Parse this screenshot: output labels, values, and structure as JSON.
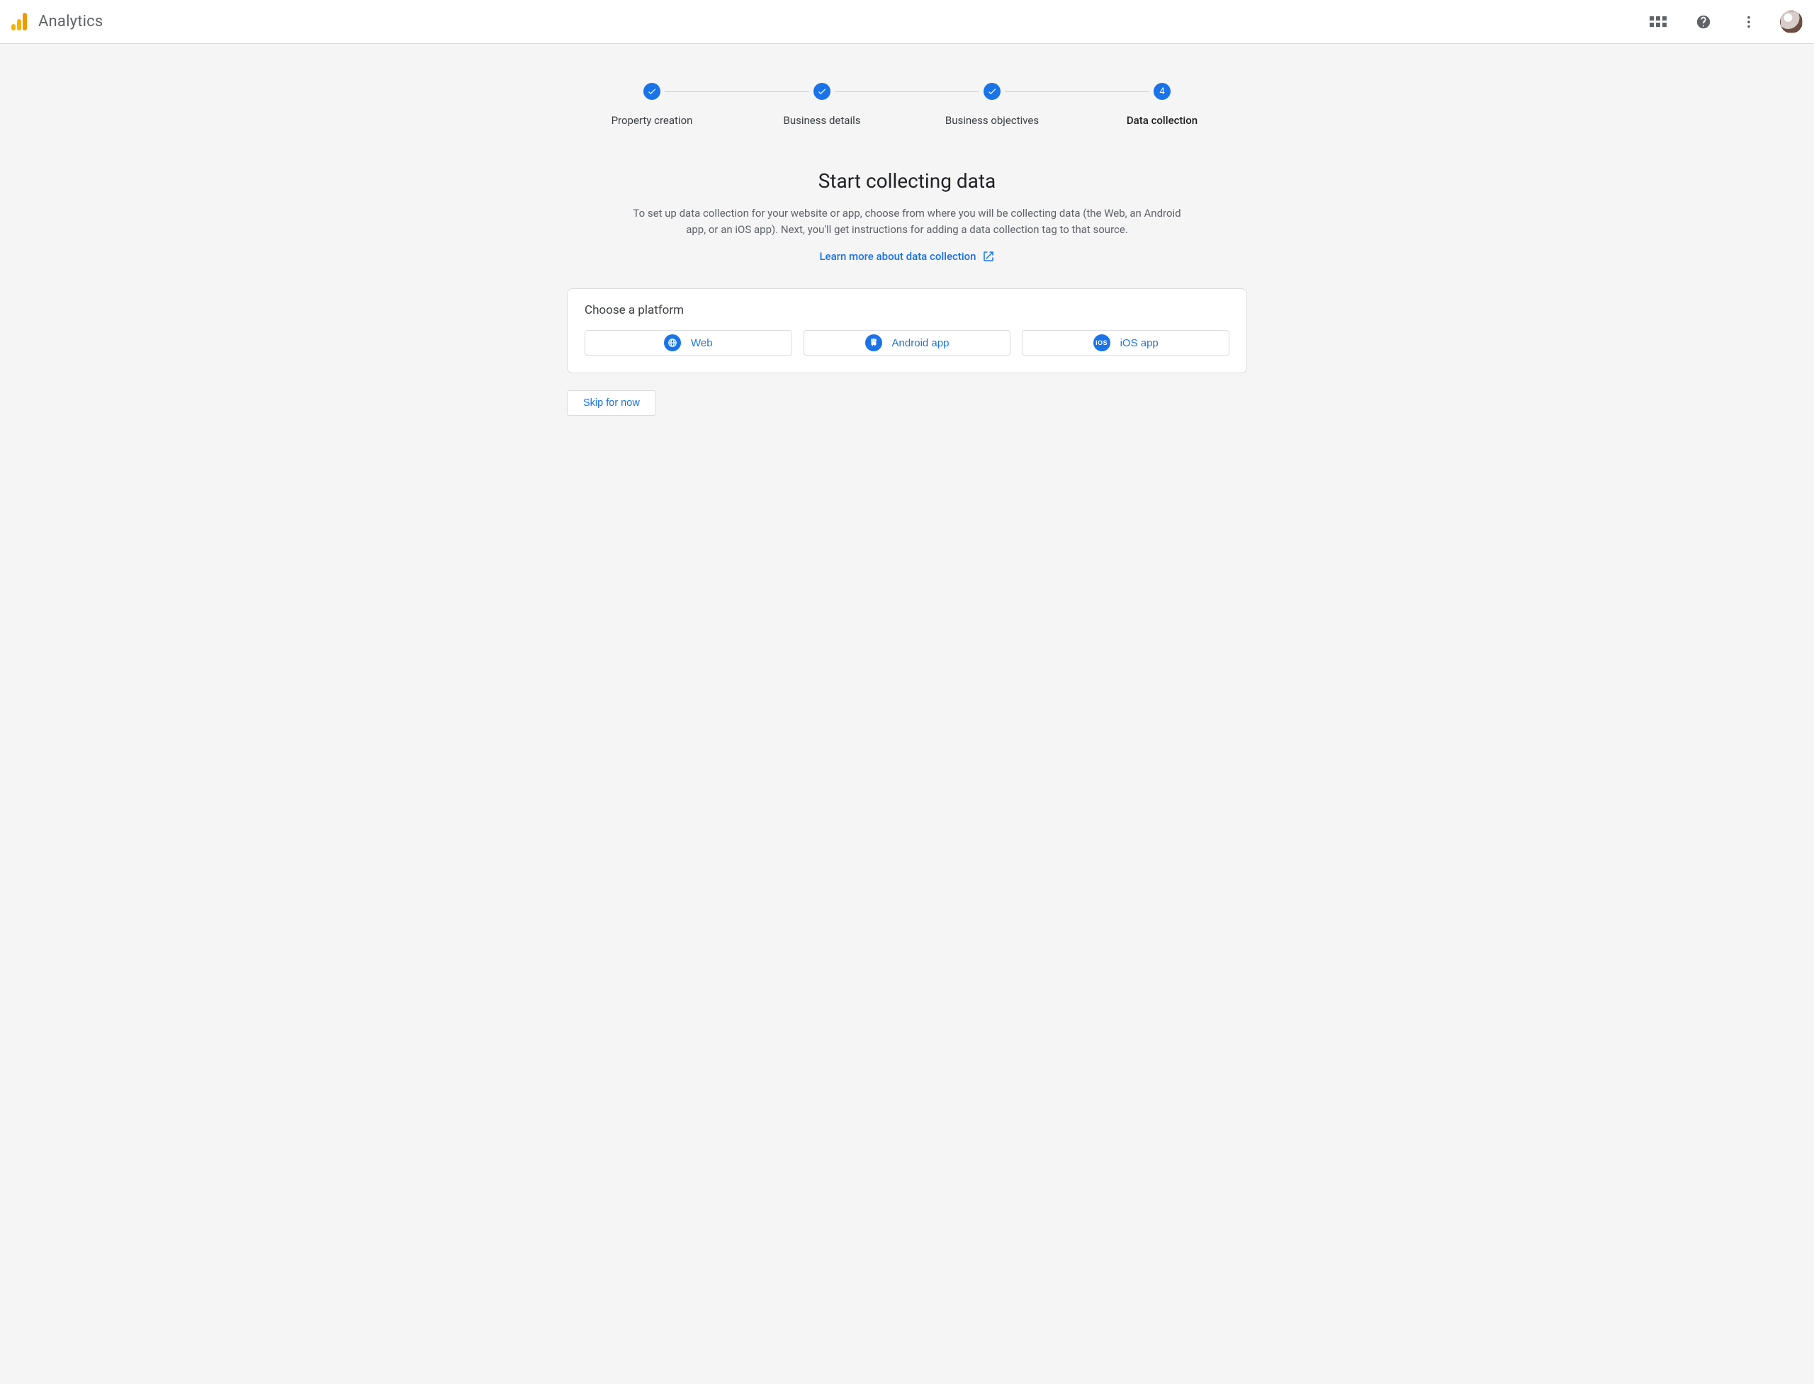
{
  "appbar": {
    "title": "Analytics"
  },
  "stepper": {
    "steps": [
      {
        "label": "Property creation",
        "done": true,
        "active": false
      },
      {
        "label": "Business details",
        "done": true,
        "active": false
      },
      {
        "label": "Business objectives",
        "done": true,
        "active": false
      },
      {
        "label": "Data collection",
        "done": false,
        "active": true,
        "number": "4"
      }
    ]
  },
  "headline": {
    "title": "Start collecting data",
    "subtitle": "To set up data collection for your website or app, choose from where you will be collecting data (the Web, an Android app, or an iOS app). Next, you'll get instructions for adding a data collection tag to that source.",
    "learn_link": "Learn more about data collection"
  },
  "card": {
    "title": "Choose a platform",
    "options": [
      {
        "label": "Web"
      },
      {
        "label": "Android app"
      },
      {
        "label": "iOS app"
      }
    ]
  },
  "buttons": {
    "skip": "Skip for now"
  }
}
